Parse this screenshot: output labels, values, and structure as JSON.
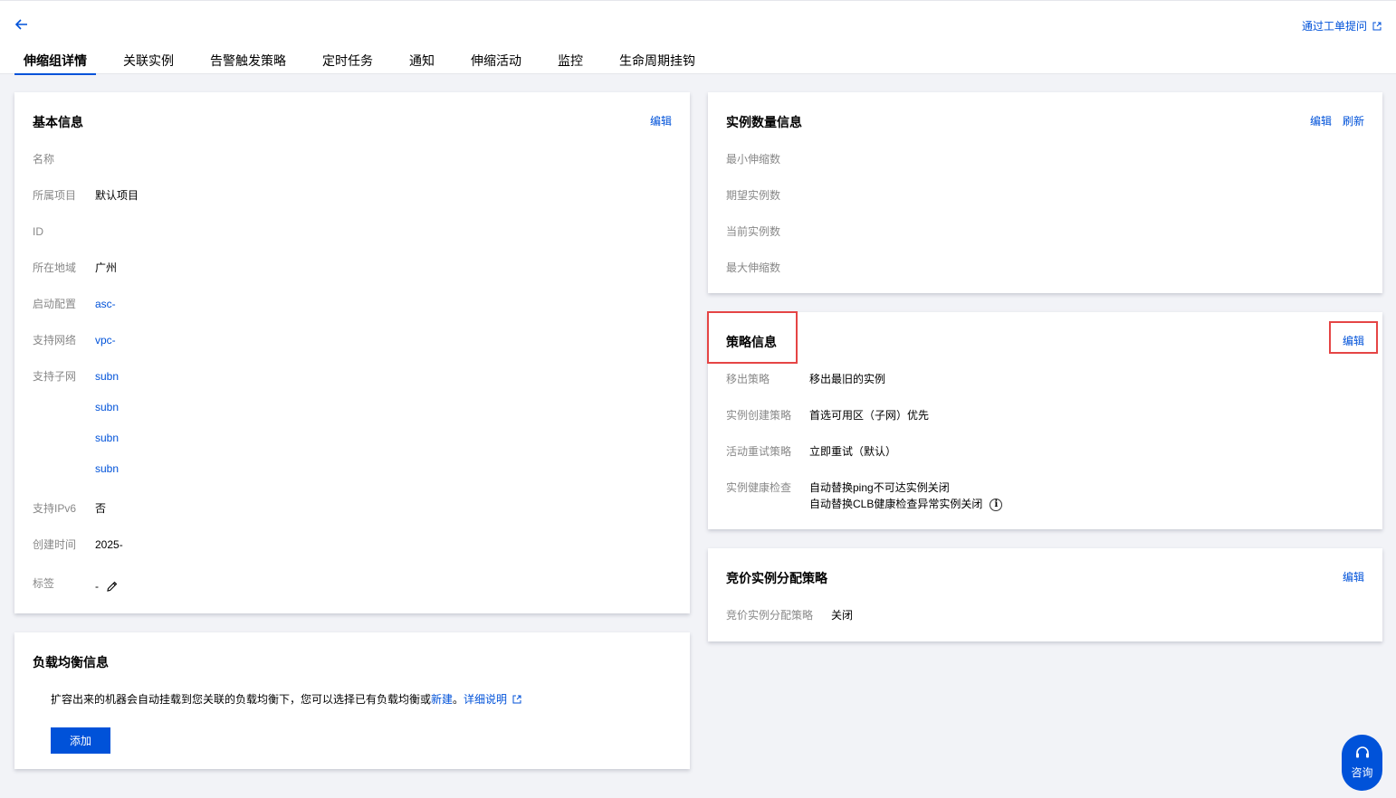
{
  "header": {
    "ticket_link": "通过工单提问",
    "tabs": [
      "伸缩组详情",
      "关联实例",
      "告警触发策略",
      "定时任务",
      "通知",
      "伸缩活动",
      "监控",
      "生命周期挂钩"
    ]
  },
  "basic": {
    "title": "基本信息",
    "edit": "编辑",
    "rows": [
      {
        "k": "名称",
        "v": ""
      },
      {
        "k": "所属项目",
        "v": "默认项目"
      },
      {
        "k": "ID",
        "v": ""
      },
      {
        "k": "所在地域",
        "v": "广州"
      },
      {
        "k": "启动配置",
        "v": "asc-"
      },
      {
        "k": "支持网络",
        "v": "vpc-"
      },
      {
        "k": "支持子网",
        "v": "subn"
      },
      {
        "k": "",
        "v": "subn"
      },
      {
        "k": "",
        "v": "subn"
      },
      {
        "k": "",
        "v": "subn"
      },
      {
        "k": "支持IPv6",
        "v": "否"
      },
      {
        "k": "创建时间",
        "v": "2025-"
      },
      {
        "k": "标签",
        "v": "-"
      }
    ]
  },
  "lb": {
    "title": "负载均衡信息",
    "desc": "扩容出来的机器会自动挂载到您关联的负载均衡下，您可以选择已有负载均衡或",
    "new_link": "新建",
    "period": "。",
    "detail_link": "详细说明",
    "add_button": "添加"
  },
  "instances": {
    "title": "实例数量信息",
    "edit": "编辑",
    "refresh": "刷新",
    "rows": [
      {
        "k": "最小伸缩数",
        "v": ""
      },
      {
        "k": "期望实例数",
        "v": ""
      },
      {
        "k": "当前实例数",
        "v": ""
      },
      {
        "k": "最大伸缩数",
        "v": ""
      }
    ]
  },
  "policy": {
    "title": "策略信息",
    "edit": "编辑",
    "rows": [
      {
        "k": "移出策略",
        "v": "移出最旧的实例"
      },
      {
        "k": "实例创建策略",
        "v": "首选可用区（子网）优先"
      },
      {
        "k": "活动重试策略",
        "v": "立即重试（默认）"
      }
    ],
    "health_key": "实例健康检查",
    "health_line1": "自动替换ping不可达实例关闭",
    "health_line2": "自动替换CLB健康检查异常实例关闭",
    "health_info_glyph": "i"
  },
  "spot": {
    "title": "竞价实例分配策略",
    "edit": "编辑",
    "k": "竞价实例分配策略",
    "v": "关闭"
  },
  "consult": {
    "label": "咨询"
  },
  "colors": {
    "primary": "#0052d9",
    "highlight": "#e54545",
    "background": "#f2f3f7"
  }
}
